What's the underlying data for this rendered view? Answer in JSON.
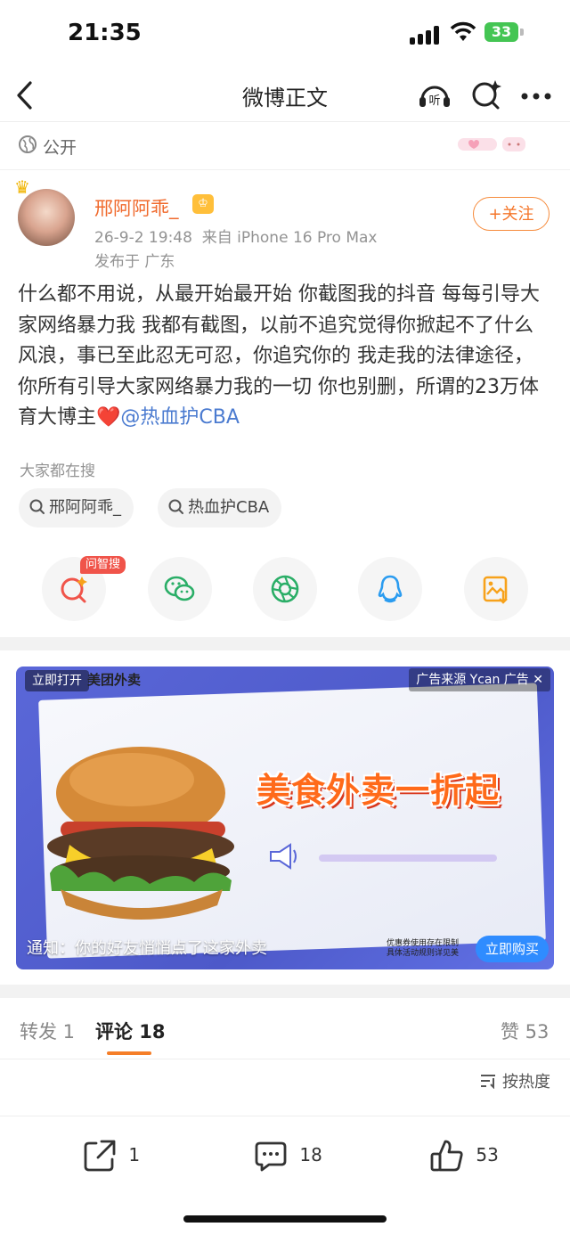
{
  "status_bar": {
    "time": "21:35",
    "battery": "33"
  },
  "nav": {
    "back": "‹",
    "title": "微博正文"
  },
  "visibility": {
    "label": "公开"
  },
  "author": {
    "name": "邢阿阿乖_",
    "timestamp": "26-9-2 19:48",
    "source": "来自 iPhone 16 Pro Max",
    "location": "发布于 广东",
    "follow_label": "+关注"
  },
  "post": {
    "text": "什么都不用说，从最开始最开始 你截图我的抖音 每每引导大家网络暴力我 我都有截图，以前不追究觉得你掀起不了什么风浪，事已至此忍无可忍，你追究你的 我走我的法律途径，你所有引导大家网络暴力我的一切 你也别删，所谓的23万体育大博主",
    "heart": "❤️",
    "mention": "@热血护CBA"
  },
  "hot_search": {
    "label": "大家都在搜",
    "chips": [
      "邢阿阿乖_",
      "热血护CBA"
    ]
  },
  "share": {
    "zhisou_badge": "问智搜",
    "icons": [
      "zhisou-icon",
      "wechat-icon",
      "moments-icon",
      "qq-icon",
      "save-image-icon"
    ]
  },
  "ad": {
    "open_label": "立即打开",
    "brand": "美团外卖",
    "source": "广告来源 Ycan 广告 ✕",
    "headline": "美食外卖一折起",
    "notice": "通知：你的好友悄悄点了这家外卖",
    "fine_print_1": "优惠券使用存在限制",
    "fine_print_2": "具体活动规则详见美",
    "buy_label": "立即购买"
  },
  "tabs": {
    "repost": "转发 1",
    "comment": "评论 18",
    "like": "赞 53"
  },
  "sort_label": "按热度",
  "bottom_bar": {
    "repost_count": "1",
    "comment_count": "18",
    "like_count": "53"
  }
}
